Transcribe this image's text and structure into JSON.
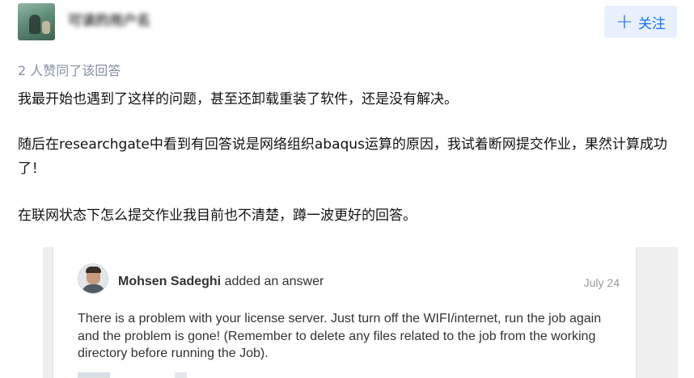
{
  "header": {
    "username": "可读的用户名",
    "follow_label": "关注",
    "follow_icon": "plus-icon"
  },
  "answer": {
    "upvote_text": "2 人赞同了该回答",
    "paragraphs": [
      "我最开始也遇到了这样的问题，甚至还卸载重装了软件，还是没有解决。",
      "随后在researchgate中看到有回答说是网络组织abaqus运算的原因，我试着断网提交作业，果然计算成功了！",
      "在联网状态下怎么提交作业我目前也不清楚，蹲一波更好的回答。"
    ]
  },
  "embedded": {
    "author_name": "Mohsen Sadeghi",
    "action": "added an answer",
    "date": "July 24",
    "text": "There is a problem with your license server. Just turn off the WIFI/internet, run the job again and the problem is gone! (Remember to delete any files related to the job from the working directory before running the Job)."
  },
  "colors": {
    "accent": "#1772f6",
    "follow_bg": "#e8f0fd",
    "meta_gray": "#8590a6"
  }
}
